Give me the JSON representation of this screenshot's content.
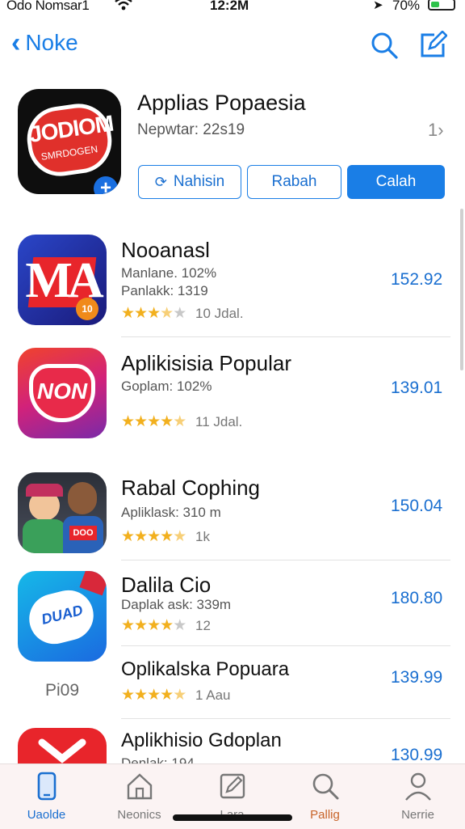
{
  "status_bar": {
    "carrier": "Odo Nomsar1",
    "time": "12:2M",
    "battery_percent": "70%"
  },
  "nav": {
    "back_label": "Noke"
  },
  "featured": {
    "icon_text_main": "JODIOM",
    "icon_text_sub": "SMRDOGEN",
    "title": "Applias Popaesia",
    "subtitle": "Nepwtar: 22s19",
    "buttons": [
      "Nahisin",
      "Rabah",
      "Calah"
    ]
  },
  "apps": [
    {
      "name": "Nooanasl",
      "meta1": "Manlane. 102%",
      "meta2": "Panlakk: 1319",
      "rating": 3.5,
      "count": "10 Jdal.",
      "price": "152.92",
      "icon_text": "MA",
      "icon_badge": "10"
    },
    {
      "name": "Aplikisisia Popular",
      "meta1": "Goplam: 102%",
      "meta2": "",
      "rating": 4.5,
      "count": "11 Jdal.",
      "price": "139.01",
      "icon_text": "NON"
    },
    {
      "name": "Rabal Cophing",
      "meta1": "Apliklask: 310 m",
      "meta2": "",
      "rating": 4.5,
      "count": "1k",
      "price": "150.04",
      "icon_text": "DOO"
    },
    {
      "name": "Dalila Cio",
      "meta1": "Daplak ask: 339m",
      "meta2": "",
      "rating": 4,
      "count": "12",
      "price": "180.80",
      "icon_text": "DUAD"
    },
    {
      "name": "Oplikalska Popuara",
      "meta1": "",
      "meta2": "",
      "rating": 4.5,
      "count": "1 Aau",
      "price": "139.99",
      "side_label": "Pi09"
    },
    {
      "name": "Aplikhisio Gdoplan",
      "meta1": "Denlak: 194",
      "meta2": "",
      "rating": 0,
      "count": "",
      "price": "130.99"
    }
  ],
  "tabs": [
    {
      "label": "Uaolde",
      "icon": "phone-icon",
      "active": true
    },
    {
      "label": "Neonics",
      "icon": "home-icon",
      "active": false
    },
    {
      "label": "Lara",
      "icon": "edit-icon",
      "active": false
    },
    {
      "label": "Pallig",
      "icon": "search-icon",
      "active": false
    },
    {
      "label": "Nerrie",
      "icon": "person-icon",
      "active": false
    }
  ],
  "colors": {
    "accent": "#1a7ee6",
    "star": "#f2b01e",
    "tab_active_label": "#1a6fd0",
    "tab_search_label": "#c8642a"
  }
}
